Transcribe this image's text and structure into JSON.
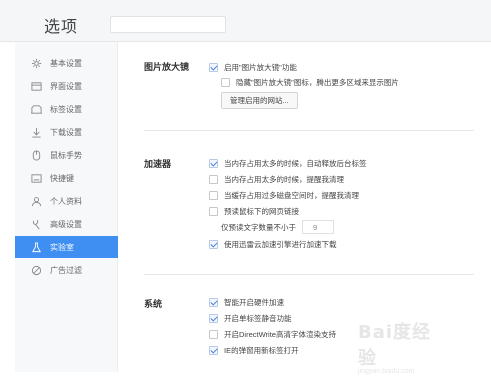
{
  "header": {
    "title": "选项"
  },
  "sidebar": {
    "items": [
      {
        "label": "基本设置",
        "icon": "gear-icon"
      },
      {
        "label": "界面设置",
        "icon": "window-icon"
      },
      {
        "label": "标签设置",
        "icon": "tag-icon"
      },
      {
        "label": "下载设置",
        "icon": "download-icon"
      },
      {
        "label": "鼠标手势",
        "icon": "mouse-icon"
      },
      {
        "label": "快捷键",
        "icon": "keyboard-icon"
      },
      {
        "label": "个人资料",
        "icon": "user-icon"
      },
      {
        "label": "高级设置",
        "icon": "advanced-icon"
      },
      {
        "label": "实验室",
        "icon": "lab-icon",
        "active": true
      },
      {
        "label": "广告过滤",
        "icon": "block-icon"
      }
    ]
  },
  "sections": {
    "magnifier": {
      "label": "图片放大镜",
      "enable": "启用\"图片放大镜\"功能",
      "hide_icon": "隐藏\"图片放大镜\"图标，腾出更多区域来显示图片",
      "manage_button": "管理启用的网站..."
    },
    "accelerator": {
      "label": "加速器",
      "opt1": "当内存占用太多的时候，自动释放后台标签",
      "opt2": "当内存占用太多的时候，提醒我清理",
      "opt3": "当缓存占用过多磁盘空间时，提醒我清理",
      "opt4": "预读鼠标下的网页链接",
      "prefetch_label": "仅预读文字数量不小于",
      "prefetch_value": "9",
      "opt5": "使用迅雷云加速引擎进行加速下载"
    },
    "system": {
      "label": "系统",
      "opt1": "智能开启硬件加速",
      "opt2": "开启单标签静音功能",
      "opt3": "开启DirectWrite高清字体渲染支持",
      "opt4": "IE的弹窗用新标签打开"
    }
  },
  "watermark": {
    "main": "Bai度经验",
    "sub": "jingyan.baidu.com"
  },
  "colors": {
    "accent": "#3f8ff2",
    "sidebar_bg": "#f7f8f9"
  }
}
